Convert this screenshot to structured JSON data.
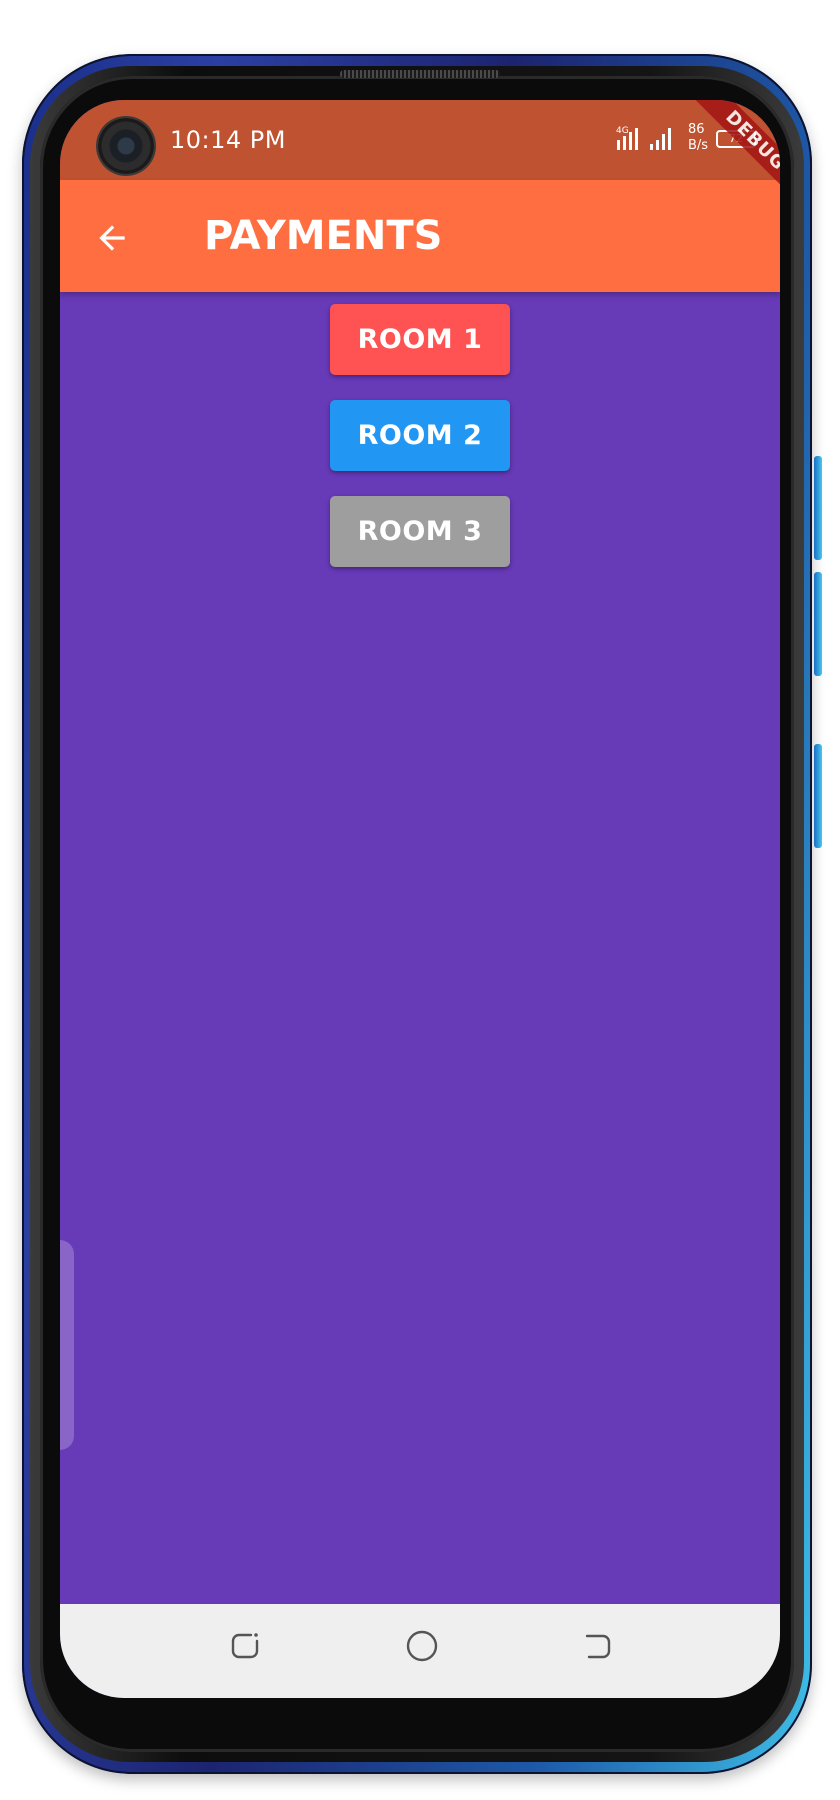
{
  "status_bar": {
    "time": "10:14 PM",
    "network_type": "4G",
    "net_speed_value": "86",
    "net_speed_unit": "B/s",
    "battery_level": "72"
  },
  "debug_banner": "DEBUG",
  "app_bar": {
    "title": "PAYMENTS",
    "back_icon": "arrow-left-icon"
  },
  "rooms": [
    {
      "label": "ROOM 1",
      "color": "#ff5252"
    },
    {
      "label": "ROOM 2",
      "color": "#2196f3"
    },
    {
      "label": "ROOM 3",
      "color": "#9e9e9e"
    }
  ],
  "nav_bar": {
    "recents_icon": "recents-icon",
    "home_icon": "home-icon",
    "back_icon": "back-icon"
  },
  "colors": {
    "status_bar": "#bf5230",
    "app_bar": "#ff6e40",
    "background": "#673ab7",
    "nav_bar": "#efefef"
  }
}
